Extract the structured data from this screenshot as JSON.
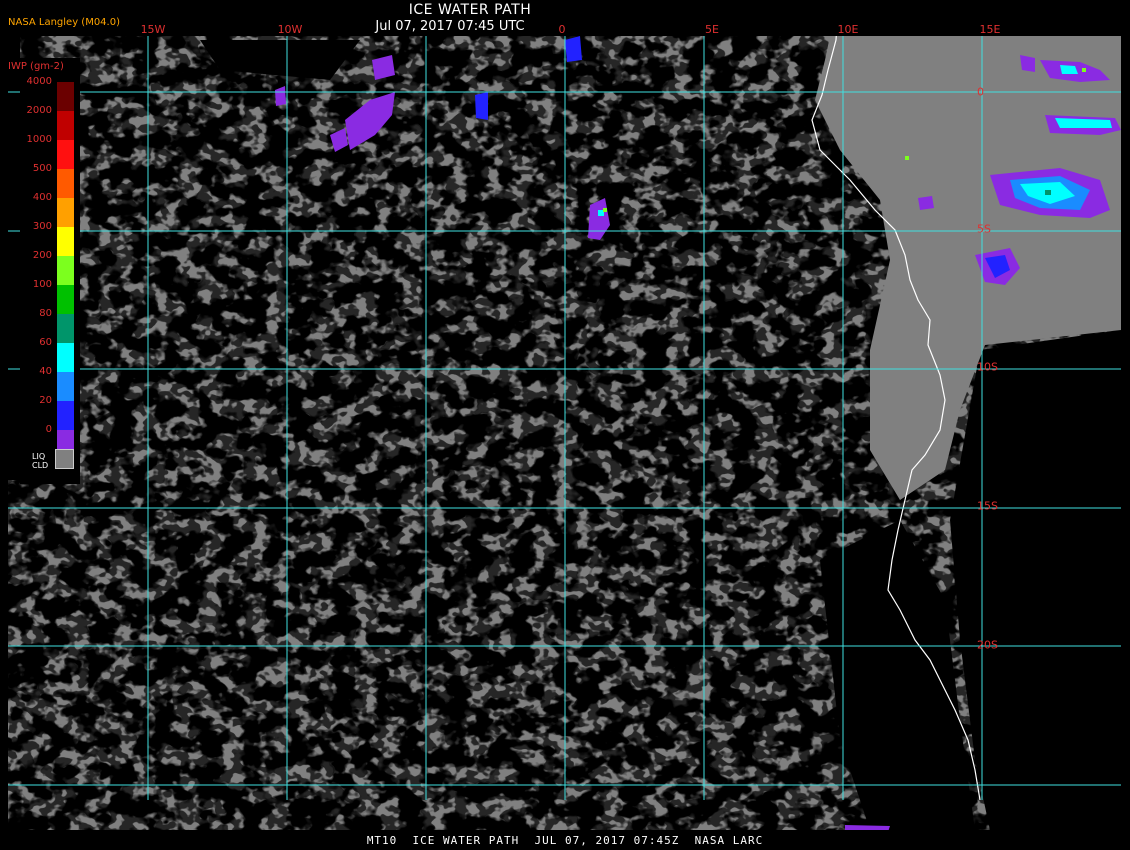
{
  "header": {
    "title": "ICE WATER PATH",
    "timestamp": "Jul 07, 2017 07:45 UTC",
    "producer": "NASA Langley (M04.0)"
  },
  "footer": {
    "caption": "MT10  ICE WATER PATH  JUL 07, 2017 07:45Z  NASA LARC"
  },
  "map": {
    "longitude_labels": [
      "15W",
      "10W",
      "0",
      "5E",
      "10E",
      "15E"
    ],
    "latitude_labels": [
      "0",
      "5S",
      "10S",
      "15S",
      "20S"
    ],
    "colors": {
      "ocean": "#000000",
      "liquid_cloud": "#808080",
      "gridline": "#40e0e0",
      "coastline": "#ffffff",
      "grid_label": "#e03030"
    }
  },
  "legend": {
    "title": "IWP (gm-2)",
    "ticks": [
      "4000",
      "2000",
      "1000",
      "500",
      "400",
      "300",
      "200",
      "100",
      "80",
      "60",
      "40",
      "20",
      "0"
    ],
    "colors": [
      "#6b0000",
      "#c00000",
      "#ff1010",
      "#ff5a00",
      "#ffa000",
      "#ffff00",
      "#7cff1e",
      "#00c000",
      "#00956a",
      "#00ffff",
      "#1a8cff",
      "#2222ff",
      "#8a2be2"
    ],
    "liquid_cloud_label": "LIQ CLD",
    "liquid_cloud_color": "#808080"
  }
}
